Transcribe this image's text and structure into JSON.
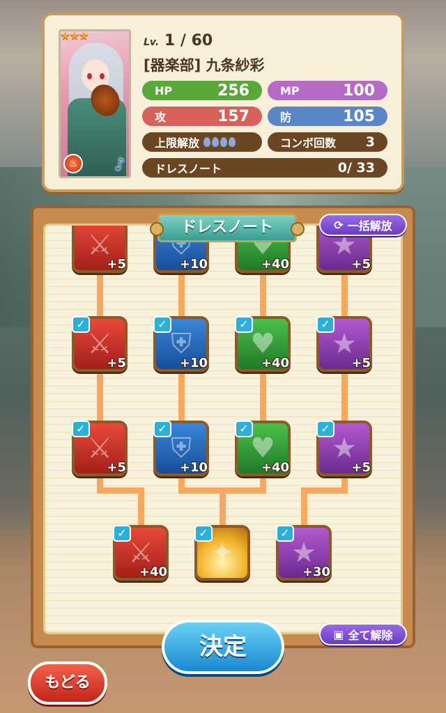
{
  "character": {
    "rarity_stars": "★★★",
    "level_prefix": "Lv.",
    "level": "1 / 60",
    "name": "[器楽部] 九条紗彩",
    "element_icon": "fire-icon",
    "type_icon": "music-note-icon"
  },
  "stats": {
    "hp_label": "HP",
    "hp_value": "256",
    "mp_label": "MP",
    "mp_value": "100",
    "atk_label": "攻",
    "atk_value": "157",
    "def_label": "防",
    "def_value": "105",
    "limit_label": "上限解放",
    "limit_break_level": 0,
    "limit_break_max": 4,
    "combo_label": "コンボ回数",
    "combo_value": "3",
    "dress_note_label": "ドレスノート",
    "dress_note_value": "0/ 33"
  },
  "dress_note": {
    "title": "ドレスノート",
    "unlock_all_label": "一括解放",
    "clear_all_label": "全て解除",
    "rows": [
      [
        {
          "color": "red",
          "icon": "sword-icon",
          "bonus": "+5",
          "checked": false
        },
        {
          "color": "blue",
          "icon": "shield-icon",
          "bonus": "+10",
          "checked": false
        },
        {
          "color": "green",
          "icon": "heart-icon",
          "bonus": "+40",
          "checked": false
        },
        {
          "color": "purple",
          "icon": "star-icon",
          "bonus": "+5",
          "checked": false
        }
      ],
      [
        {
          "color": "red",
          "icon": "sword-icon",
          "bonus": "+5",
          "checked": true
        },
        {
          "color": "blue",
          "icon": "shield-icon",
          "bonus": "+10",
          "checked": true
        },
        {
          "color": "green",
          "icon": "heart-icon",
          "bonus": "+40",
          "checked": true
        },
        {
          "color": "purple",
          "icon": "star-icon",
          "bonus": "+5",
          "checked": true
        }
      ],
      [
        {
          "color": "red",
          "icon": "sword-icon",
          "bonus": "+5",
          "checked": true
        },
        {
          "color": "blue",
          "icon": "shield-icon",
          "bonus": "+10",
          "checked": true
        },
        {
          "color": "green",
          "icon": "heart-icon",
          "bonus": "+40",
          "checked": true
        },
        {
          "color": "purple",
          "icon": "star-icon",
          "bonus": "+5",
          "checked": true
        }
      ],
      [
        {
          "color": "red",
          "icon": "sword-icon",
          "bonus": "+40",
          "checked": true
        },
        {
          "color": "gold",
          "icon": "spotlight-icon",
          "bonus": "",
          "checked": true
        },
        {
          "color": "purple",
          "icon": "star-icon",
          "bonus": "+30",
          "checked": true
        }
      ]
    ]
  },
  "buttons": {
    "decide": "決定",
    "back": "もどる"
  },
  "colors": {
    "hp": "#5aa83a",
    "mp": "#b56ac6",
    "atk": "#d8605a",
    "def": "#5a86c8",
    "accent": "#2bb0d8"
  }
}
